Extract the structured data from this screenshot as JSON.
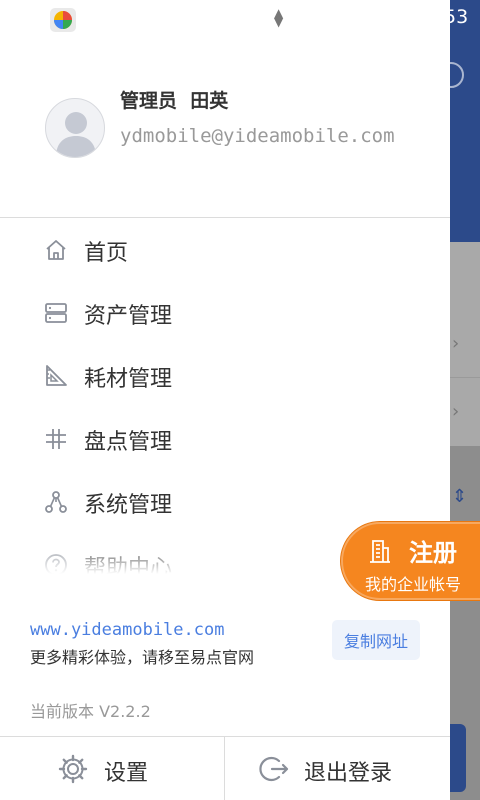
{
  "status_bar": {
    "clock": "53",
    "data_arrows": "▲▼"
  },
  "profile": {
    "name": "管理员  田英",
    "email": "ydmobile@yideamobile.com"
  },
  "menu": {
    "items": [
      {
        "label": "首页",
        "icon": "home-icon"
      },
      {
        "label": "资产管理",
        "icon": "server-icon"
      },
      {
        "label": "耗材管理",
        "icon": "ruler-icon"
      },
      {
        "label": "盘点管理",
        "icon": "hash-icon"
      },
      {
        "label": "系统管理",
        "icon": "nodes-icon"
      },
      {
        "label": "帮助中心",
        "icon": "help-icon"
      }
    ]
  },
  "info": {
    "website": "www.yideamobile.com",
    "website_note": "更多精彩体验，请移至易点官网",
    "copy_label": "复制网址",
    "version": "当前版本 V2.2.2"
  },
  "footer": {
    "settings_label": "设置",
    "logout_label": "退出登录"
  },
  "register": {
    "title": "注册",
    "subtitle": "我的企业帐号"
  },
  "colors": {
    "accent_blue": "#4a7ee0",
    "brand_orange": "#f5861f",
    "header_navy": "#2c4a8a"
  }
}
